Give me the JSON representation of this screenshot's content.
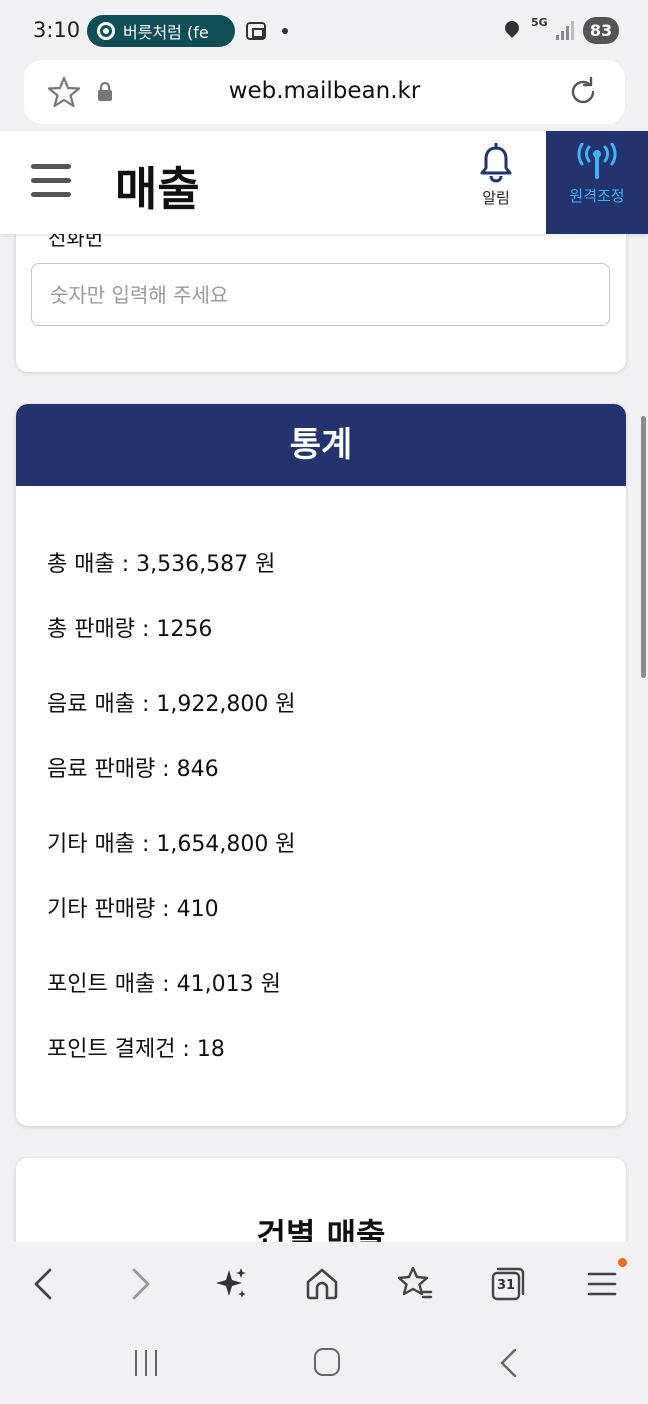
{
  "status_bar": {
    "time": "3:10",
    "notification": "버릇처럼 (fe",
    "network": "5G",
    "battery": "83"
  },
  "browser": {
    "url": "web.mailbean.kr"
  },
  "header": {
    "title": "매출",
    "bell_label": "알림",
    "remote_label": "원격조정",
    "remote_color": "#3fb3f5",
    "header_bg": "#22336e"
  },
  "filter_card": {
    "label": "전화번",
    "input_placeholder": "숫자만 입력해 주세요",
    "input_value": ""
  },
  "stats": {
    "title": "통계",
    "lines": [
      "총 매출 : 3,536,587 원",
      "총 판매량 : 1256",
      "음료 매출 : 1,922,800 원",
      "음료 판매량 : 846",
      "기타 매출 : 1,654,800 원",
      "기타 판매량 : 410",
      "포인트 매출 : 41,013 원",
      "포인트 결제건 : 18"
    ]
  },
  "next_card": {
    "title": "건별 매출"
  },
  "bottom_bar": {
    "icons": [
      "back-icon",
      "forward-icon",
      "ai-sparkle-icon",
      "home-icon",
      "bookmark-star-icon",
      "tabs-icon",
      "menu-icon"
    ],
    "tab_count": "31"
  },
  "nav_bar": {
    "icons": [
      "recent-apps-icon",
      "home-button-icon",
      "back-nav-icon"
    ]
  }
}
